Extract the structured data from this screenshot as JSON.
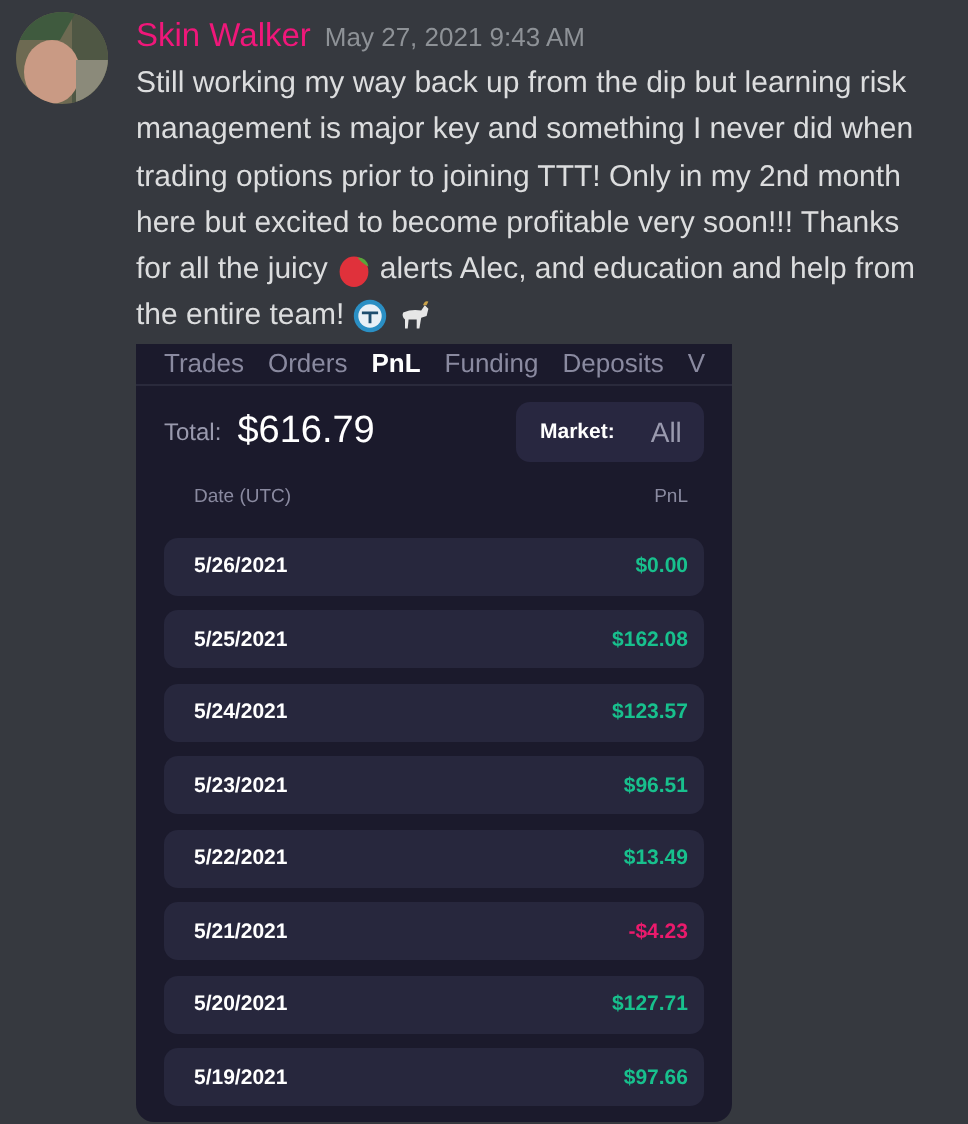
{
  "message": {
    "author": "Skin Walker",
    "timestamp": "May 27, 2021 9:43 AM",
    "lines": [
      "Still working my way back up from the dip but learning risk",
      "management is major key and something I never did when",
      "trading options prior to joining TTT! Only in my 2nd month",
      "here but excited to become profitable very soon!!! Thanks"
    ],
    "before_emoji": "for all the juicy",
    "after_emoji": "alerts Alec, and education and help from",
    "last_line": "the entire team!"
  },
  "panel": {
    "tabs": [
      {
        "label": "Trades",
        "selected": false
      },
      {
        "label": "Orders",
        "selected": false
      },
      {
        "label": "PnL",
        "selected": true
      },
      {
        "label": "Funding",
        "selected": false
      },
      {
        "label": "Deposits",
        "selected": false
      },
      {
        "label": "V",
        "selected": false
      }
    ],
    "total_label": "Total:",
    "total_value": "$616.79",
    "market_label": "Market:",
    "market_value": "All",
    "columns": [
      "Date (UTC)",
      "PnL"
    ],
    "rows": [
      {
        "date": "5/26/2021",
        "pnl": "$0.00",
        "negative": false
      },
      {
        "date": "5/25/2021",
        "pnl": "$162.08",
        "negative": false
      },
      {
        "date": "5/24/2021",
        "pnl": "$123.57",
        "negative": false
      },
      {
        "date": "5/23/2021",
        "pnl": "$96.51",
        "negative": false
      },
      {
        "date": "5/22/2021",
        "pnl": "$13.49",
        "negative": false
      },
      {
        "date": "5/21/2021",
        "pnl": "-$4.23",
        "negative": true
      },
      {
        "date": "5/20/2021",
        "pnl": "$127.71",
        "negative": false
      },
      {
        "date": "5/19/2021",
        "pnl": "$97.66",
        "negative": false
      }
    ]
  }
}
